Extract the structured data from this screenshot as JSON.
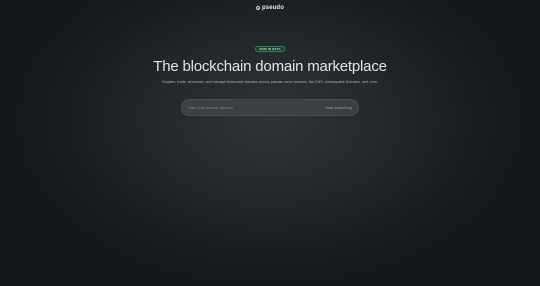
{
  "header": {
    "logo_text": "pseudo",
    "logo_icon": "circle-logo-icon"
  },
  "hero": {
    "badge": "NOW IN BETA",
    "title": "The blockchain domain marketplace",
    "subtitle": "Register, trade, showcase, and manage blockchain domains across popular name services, like ENS, Unstoppable Domains, and Lens."
  },
  "search": {
    "placeholder": "Start your search domain",
    "value": "",
    "button_label": "Start searching"
  },
  "colors": {
    "background": "#14181c",
    "badge_bg": "#1f3a2c",
    "badge_text": "#a6e0bd",
    "title_text": "#e1e6e5"
  }
}
